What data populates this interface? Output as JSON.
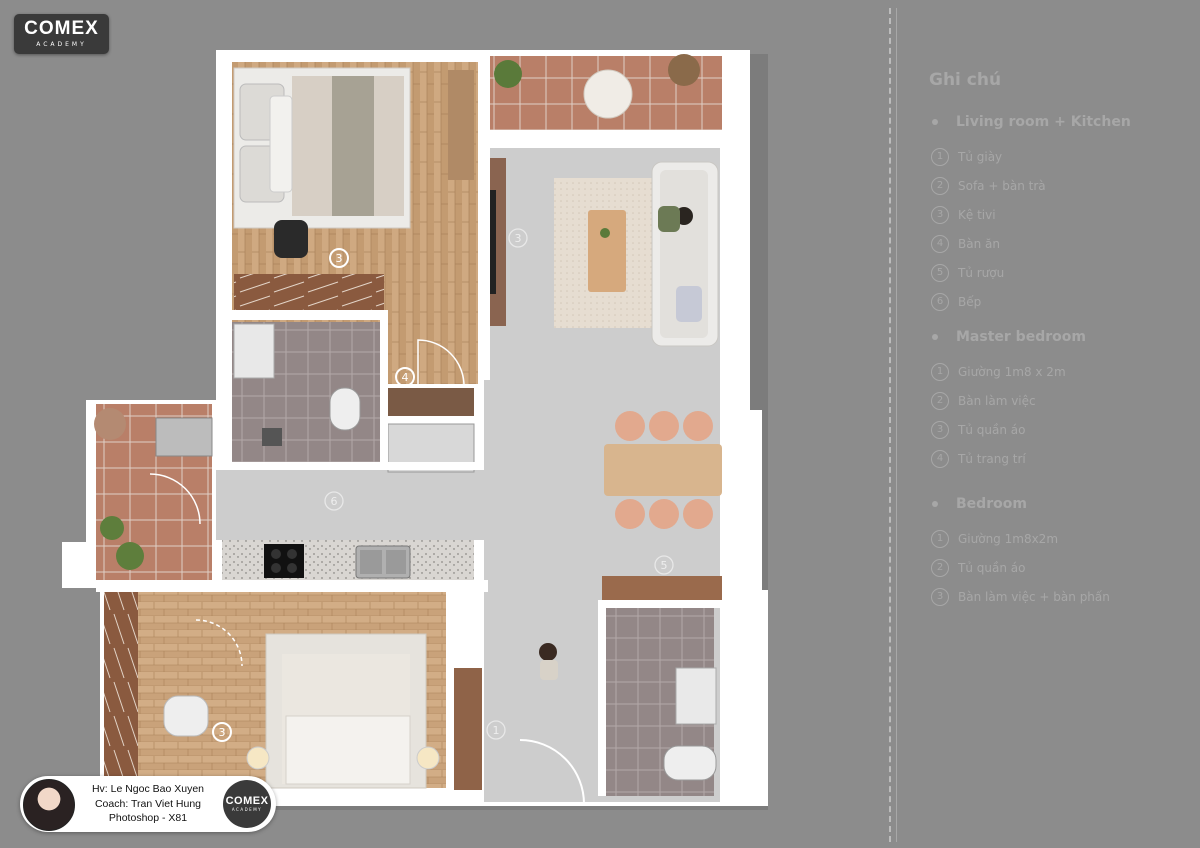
{
  "brand": {
    "name": "COMEX",
    "sub": "ACADEMY"
  },
  "legend": {
    "title": "Ghi chú",
    "sections": [
      {
        "name": "Living room + Kitchen",
        "items": [
          {
            "n": "1",
            "label": "Tủ giày"
          },
          {
            "n": "2",
            "label": "Sofa + bàn trà"
          },
          {
            "n": "3",
            "label": "Kệ tivi"
          },
          {
            "n": "4",
            "label": "Bàn ăn"
          },
          {
            "n": "5",
            "label": "Tủ rượu"
          },
          {
            "n": "6",
            "label": "Bếp"
          }
        ]
      },
      {
        "name": "Master bedroom",
        "items": [
          {
            "n": "1",
            "label": "Giường 1m8 x 2m"
          },
          {
            "n": "2",
            "label": "Bàn làm việc"
          },
          {
            "n": "3",
            "label": "Tủ quần áo"
          },
          {
            "n": "4",
            "label": "Tủ trang trí"
          }
        ]
      },
      {
        "name": "Bedroom",
        "items": [
          {
            "n": "1",
            "label": "Giường 1m8x2m"
          },
          {
            "n": "2",
            "label": "Tủ quần áo"
          },
          {
            "n": "3",
            "label": "Bàn làm việc + bàn phấn"
          }
        ]
      }
    ]
  },
  "plan_markers": [
    "3",
    "3",
    "4",
    "6",
    "5",
    "3",
    "1"
  ],
  "credit": {
    "line1": "Hv: Le Ngoc Bao Xuyen",
    "line2": "Coach: Tran Viet Hung",
    "line3": "Photoshop - X81"
  },
  "colors": {
    "background": "#8c8c8c",
    "wall": "#ffffff",
    "floor": "#cbcbcb",
    "wood": "#c49a6c",
    "tile": "#8f8484",
    "legend_text": "#a7a7a7"
  }
}
